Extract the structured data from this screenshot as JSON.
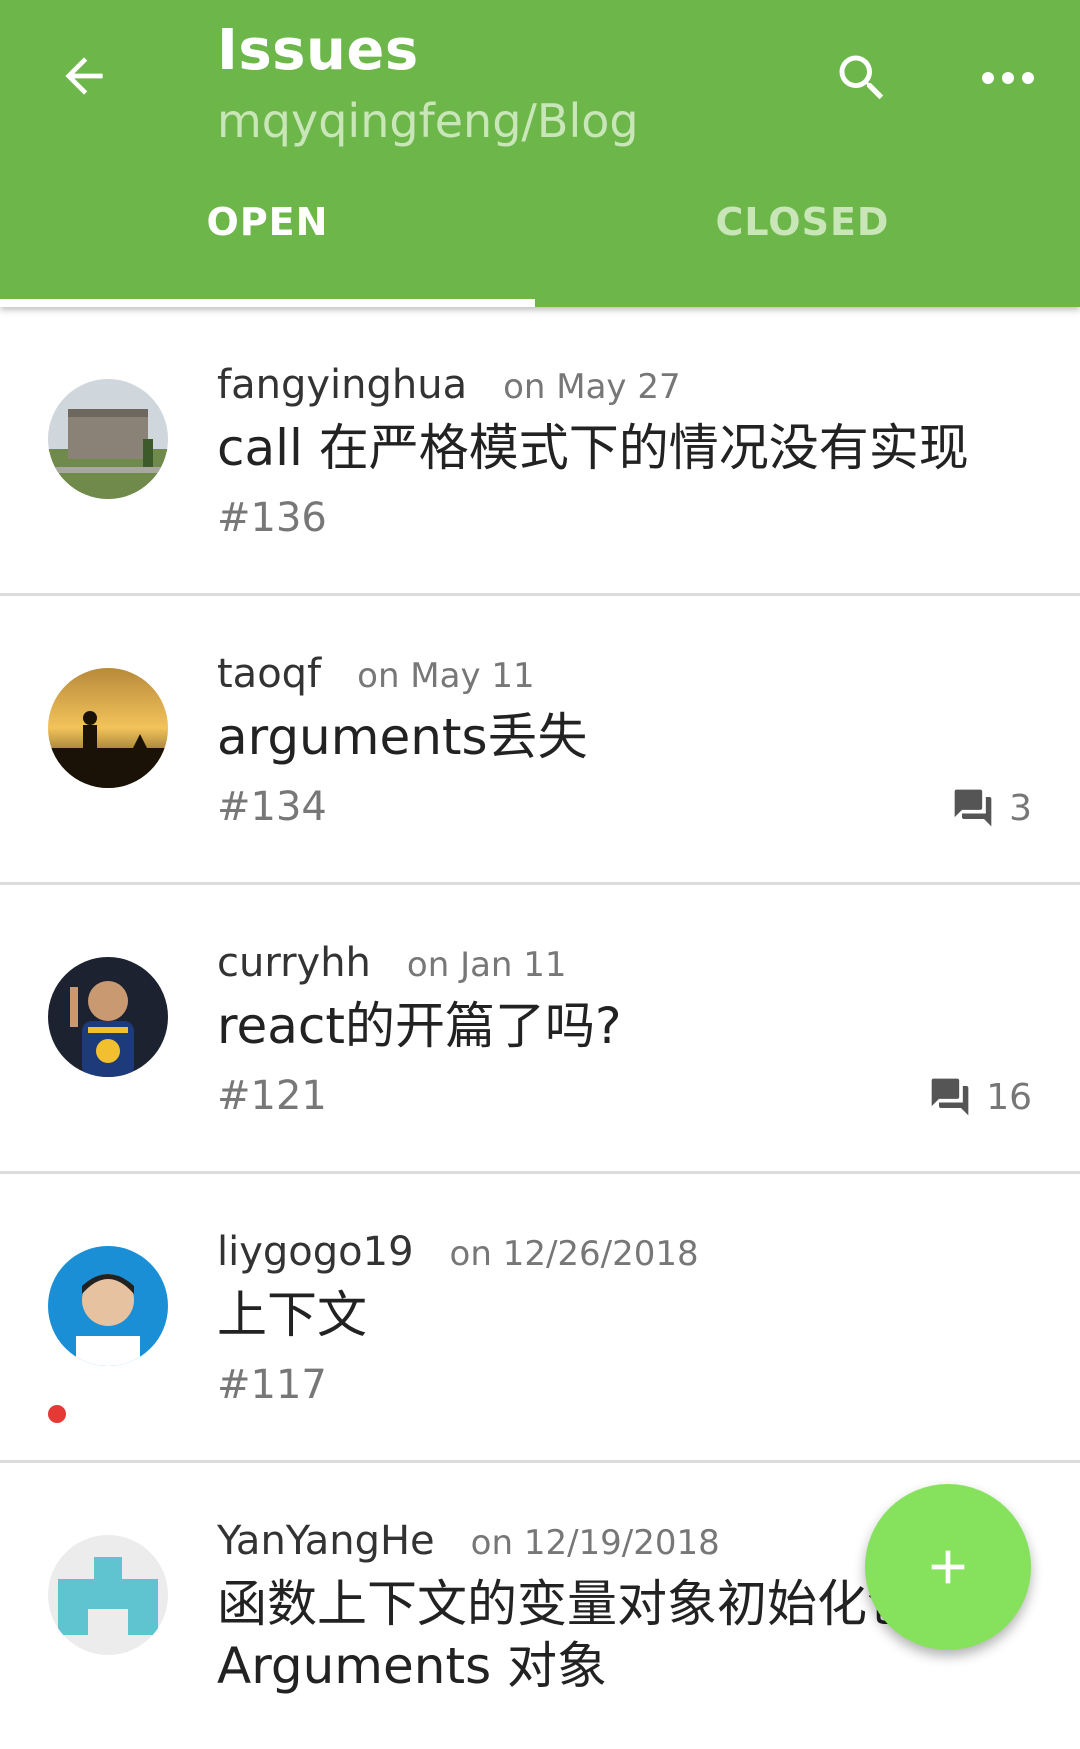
{
  "appbar": {
    "title": "Issues",
    "subtitle": "mqyqingfeng/Blog",
    "back_icon": "arrow-back-icon",
    "search_icon": "search-icon",
    "more_icon": "more-horizontal-icon",
    "color": "#6cb64a"
  },
  "tabs": [
    {
      "label": "OPEN",
      "selected": true
    },
    {
      "label": "CLOSED",
      "selected": false
    }
  ],
  "issues": [
    {
      "author": "fangyinghua",
      "date": "on May 27",
      "title": "call 在严格模式下的情况没有实现",
      "number": "#136",
      "comments": ""
    },
    {
      "author": "taoqf",
      "date": "on May 11",
      "title": "arguments丢失",
      "number": "#134",
      "comments": "3"
    },
    {
      "author": "curryhh",
      "date": "on Jan 11",
      "title": "react的开篇了吗?",
      "number": "#121",
      "comments": "16"
    },
    {
      "author": "liygogo19",
      "date": "on 12/26/2018",
      "title": "上下文",
      "number": "#117",
      "comments": ""
    },
    {
      "author": "YanYangHe",
      "date": "on 12/19/2018",
      "title": "函数上下文的变量对象初始化包括 Arguments 对象",
      "number": "",
      "comments": ""
    }
  ],
  "fab": {
    "icon": "plus-icon",
    "color": "#86e25c"
  }
}
